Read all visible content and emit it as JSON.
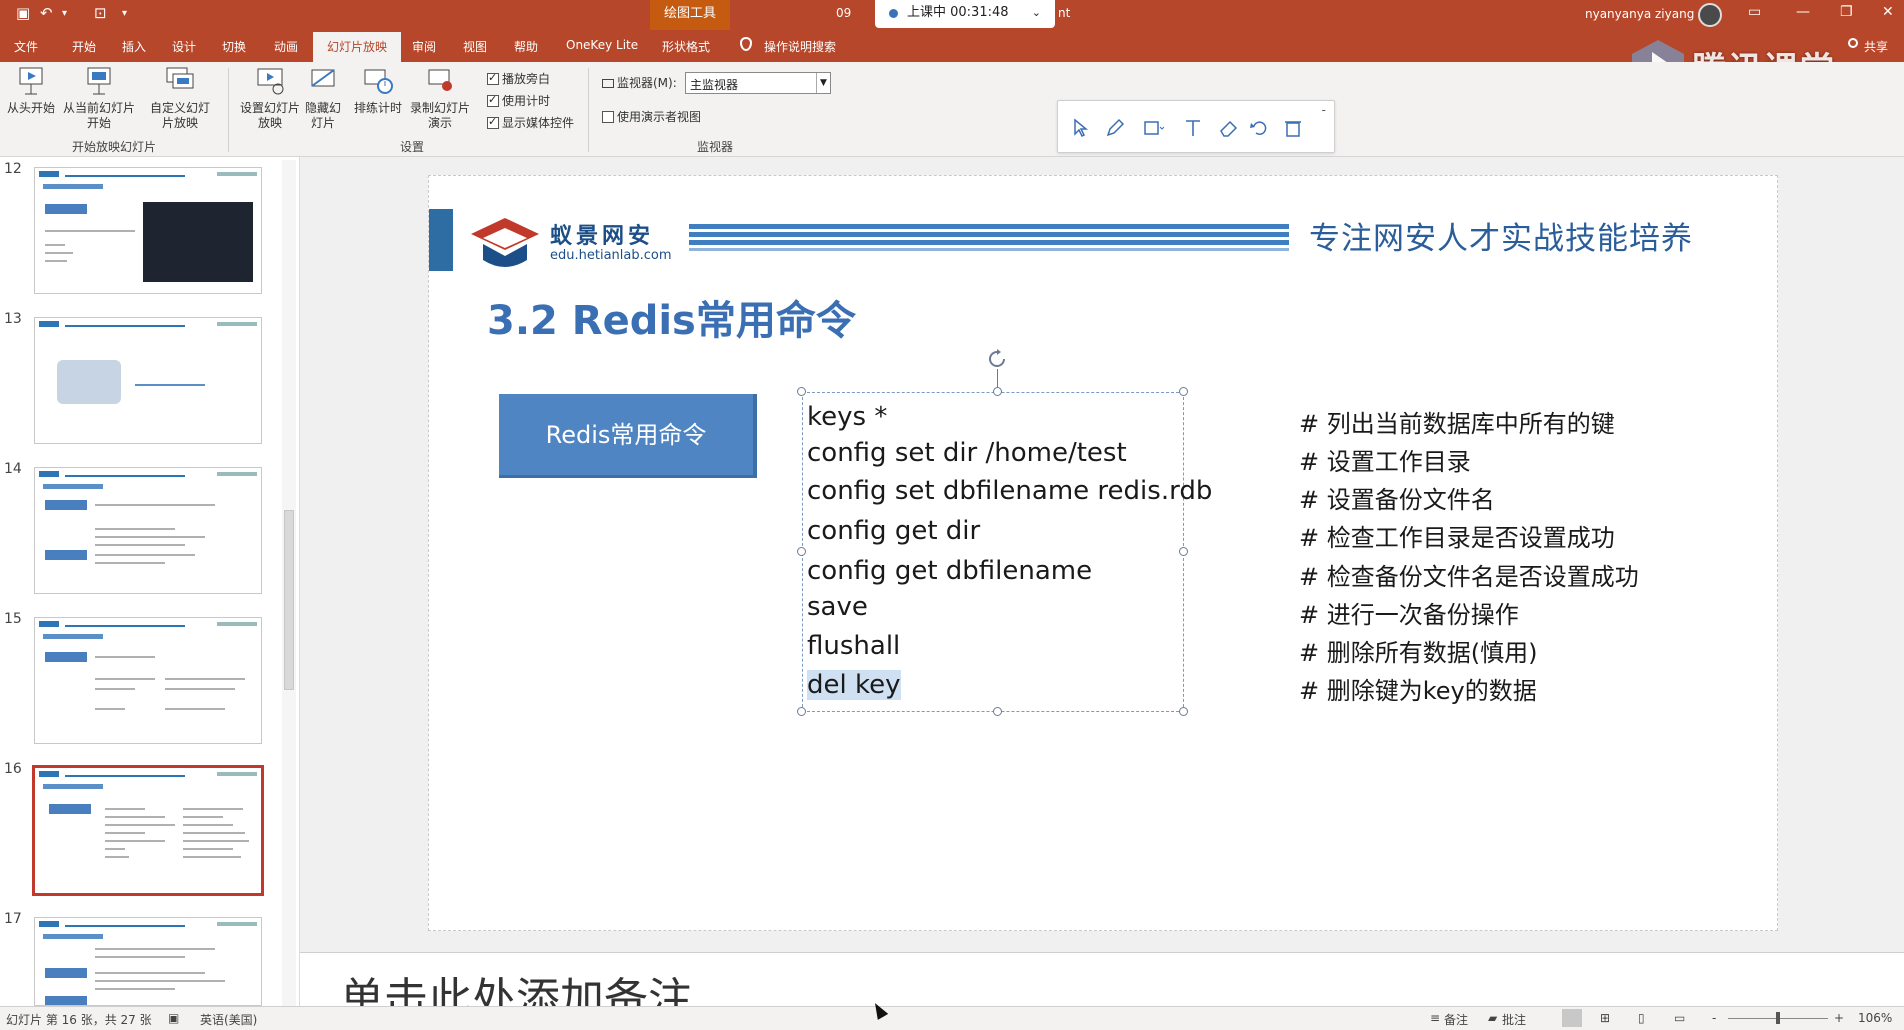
{
  "titlebar": {
    "context_tab": "绘图工具",
    "frag_left": "09",
    "frag_right": "nt",
    "live_status": "上课中 00:31:48",
    "user": "nyanyanya ziyang",
    "colors": {
      "bar": "#b7472a",
      "live_dot": "#3a72b8"
    }
  },
  "tabs": [
    "文件",
    "开始",
    "插入",
    "设计",
    "切换",
    "动画",
    "幻灯片放映",
    "审阅",
    "视图",
    "帮助",
    "OneKey Lite",
    "形状格式"
  ],
  "active_tab": "幻灯片放映",
  "tell_me": "操作说明搜索",
  "share": "共享",
  "tencent_logo_text": "腾讯课堂",
  "ribbon": {
    "start_group": {
      "buttons": [
        "从头开始",
        "从当前幻灯片开始",
        "自定义幻灯片放映"
      ],
      "label": "开始放映幻灯片"
    },
    "setup_group": {
      "buttons": [
        "设置幻灯片放映",
        "隐藏幻灯片",
        "排练计时",
        "录制幻灯片演示"
      ],
      "checkboxes": [
        {
          "label": "播放旁白",
          "checked": true
        },
        {
          "label": "使用计时",
          "checked": true
        },
        {
          "label": "显示媒体控件",
          "checked": true
        }
      ],
      "label": "设置"
    },
    "monitor_group": {
      "monitor_label": "监视器(M):",
      "monitor_value": "主监视器",
      "presenter_view": {
        "label": "使用演示者视图",
        "checked": false
      },
      "label": "监视器"
    }
  },
  "thumbnails": [
    {
      "num": "12"
    },
    {
      "num": "13"
    },
    {
      "num": "14"
    },
    {
      "num": "15"
    },
    {
      "num": "16",
      "selected": true
    },
    {
      "num": "17"
    }
  ],
  "slide": {
    "brand_cn": "蚁景网安",
    "brand_url": "edu.hetianlab.com",
    "slogan": "专注网安人才实战技能培养",
    "title": "3.2 Redis常用命令",
    "button_label": "Redis常用命令",
    "commands": [
      "keys *",
      "config set dir /home/test",
      "config set dbfilename redis.rdb",
      "config get dir",
      "config get dbfilename",
      "save",
      "flushall",
      "del key"
    ],
    "comments": [
      "# 列出当前数据库中所有的键",
      "# 设置工作目录",
      "# 设置备份文件名",
      "# 检查工作目录是否设置成功",
      "# 检查备份文件名是否设置成功",
      "# 进行一次备份操作",
      "# 删除所有数据(慎用)",
      "# 删除键为key的数据"
    ],
    "colors": {
      "title": "#3b6fb3",
      "button": "#4f85c2",
      "brand": "#1c4f88"
    }
  },
  "notes_placeholder": "单击此处添加备注",
  "minitoolbar": {
    "tools": [
      "select-arrow-icon",
      "pen-icon",
      "rectangle-icon",
      "text-icon",
      "eraser-icon",
      "undo-icon",
      "trash-icon"
    ],
    "minimize": "-"
  },
  "status": {
    "slide_info": "幻灯片 第 16 张，共 27 张",
    "language": "英语(美国)",
    "notes": "备注",
    "comments": "批注",
    "zoom": "106%",
    "zoom_minus": "-",
    "zoom_plus": "+"
  }
}
